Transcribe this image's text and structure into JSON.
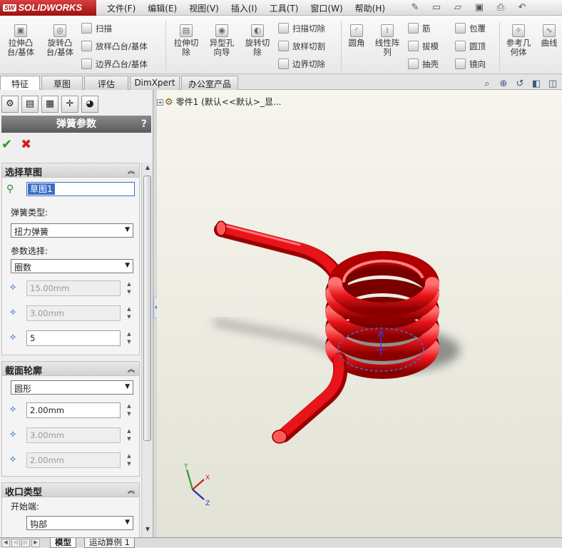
{
  "app": {
    "logo_badge": "SW",
    "logo_text": "SOLIDWORKS"
  },
  "menu": [
    "文件(F)",
    "编辑(E)",
    "视图(V)",
    "插入(I)",
    "工具(T)",
    "窗口(W)",
    "帮助(H)"
  ],
  "ribbon": {
    "extrude_boss": "拉伸凸\n台/基体",
    "revolve_boss": "旋转凸\n台/基体",
    "sweep": "扫描",
    "loft": "放样凸台/基体",
    "boundary_boss": "边界凸台/基体",
    "extrude_cut": "拉伸切\n除",
    "hole_wizard": "异型孔\n向导",
    "revolve_cut": "旋转切\n除",
    "sweep_cut": "扫描切除",
    "loft_cut": "放样切割",
    "boundary_cut": "边界切除",
    "fillet": "圆角",
    "linear_pattern": "线性阵\n列",
    "rib": "筋",
    "draft": "拔模",
    "shell": "抽壳",
    "wrap": "包覆",
    "dome": "圆顶",
    "mirror": "镜向",
    "ref_geometry": "参考几\n何体",
    "curves": "曲线"
  },
  "tabs": [
    "特征",
    "草图",
    "评估",
    "DimXpert",
    "办公室产品"
  ],
  "panel": {
    "title": "弹簧参数",
    "help": "?",
    "sections": {
      "sketch": {
        "title": "选择草图",
        "value": "草图1"
      },
      "spring_type": {
        "label": "弹簧类型:",
        "value": "扭力弹簧"
      },
      "param_select": {
        "label": "参数选择:",
        "value": "圈数"
      },
      "params": [
        "15.00mm",
        "3.00mm",
        "5"
      ],
      "profile": {
        "title": "截面轮廓",
        "shape": "圆形",
        "values": [
          "2.00mm",
          "3.00mm",
          "2.00mm"
        ]
      },
      "end_type": {
        "title": "收口类型",
        "start_label": "开始端:",
        "start_value": "钩部"
      }
    }
  },
  "tree": {
    "root": "零件1  (默认<<默认>_显..."
  },
  "bottom_tabs": [
    "模型",
    "运动算例 1"
  ],
  "colors": {
    "spring": "#e8141a",
    "selection": "#3b6fc6",
    "logo_red": "#b01010"
  }
}
